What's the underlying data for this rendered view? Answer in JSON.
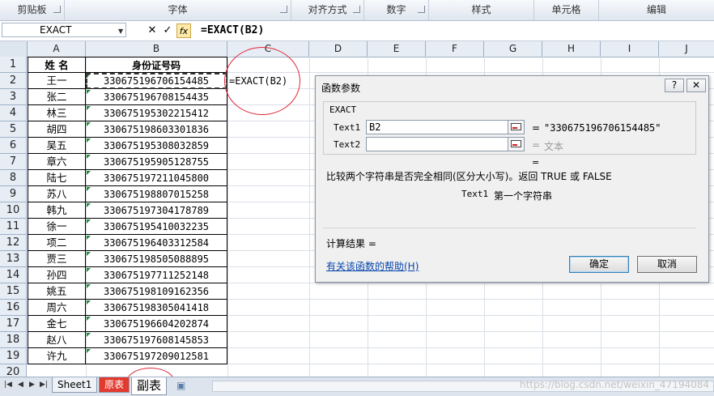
{
  "ribbon": {
    "groups": [
      "剪贴板",
      "字体",
      "对齐方式",
      "数字",
      "样式",
      "单元格",
      "编辑"
    ]
  },
  "formula_bar": {
    "name_box": "EXACT",
    "formula": "=EXACT(B2)",
    "cancel_glyph": "✕",
    "enter_glyph": "✓",
    "fx_label": "fx"
  },
  "columns": [
    "A",
    "B",
    "C",
    "D",
    "E",
    "F",
    "G",
    "H",
    "I",
    "J"
  ],
  "rows": [
    "1",
    "2",
    "3",
    "4",
    "5",
    "6",
    "7",
    "8",
    "9",
    "10",
    "11",
    "12",
    "13",
    "14",
    "15",
    "16",
    "17",
    "18",
    "19",
    "20"
  ],
  "table": {
    "headers": [
      "姓 名",
      "身份证号码"
    ],
    "records": [
      [
        "王一",
        "330675196706154485"
      ],
      [
        "张二",
        "330675196708154435"
      ],
      [
        "林三",
        "330675195302215412"
      ],
      [
        "胡四",
        "330675198603301836"
      ],
      [
        "吴五",
        "330675195308032859"
      ],
      [
        "章六",
        "330675195905128755"
      ],
      [
        "陆七",
        "330675197211045800"
      ],
      [
        "苏八",
        "330675198807015258"
      ],
      [
        "韩九",
        "330675197304178789"
      ],
      [
        "徐一",
        "330675195410032235"
      ],
      [
        "项二",
        "330675196403312584"
      ],
      [
        "贾三",
        "330675198505088895"
      ],
      [
        "孙四",
        "330675197711252148"
      ],
      [
        "姚五",
        "330675198109162356"
      ],
      [
        "周六",
        "330675198305041418"
      ],
      [
        "金七",
        "330675196604202874"
      ],
      [
        "赵八",
        "330675197608145853"
      ],
      [
        "许九",
        "330675197209012581"
      ]
    ]
  },
  "active_cell_text": "=EXACT(B2)",
  "sheet_tabs": [
    "Sheet1",
    "原表",
    "副表"
  ],
  "watermark": "https://blog.csdn.net/weixin_47194084",
  "dialog": {
    "title": "函数参数",
    "help_btn": "?",
    "close_btn": "✕",
    "function_name": "EXACT",
    "args": [
      {
        "label": "Text1",
        "value": "B2",
        "result": "\"330675196706154485\""
      },
      {
        "label": "Text2",
        "value": "",
        "result": "文本"
      }
    ],
    "equals": "=",
    "description": "比较两个字符串是否完全相同(区分大小写)。返回 TRUE 或 FALSE",
    "arg_desc_name": "Text1",
    "arg_desc_text": "第一个字符串",
    "calc_result": "计算结果 =",
    "help_link": "有关该函数的帮助(H)",
    "ok": "确定",
    "cancel": "取消"
  }
}
